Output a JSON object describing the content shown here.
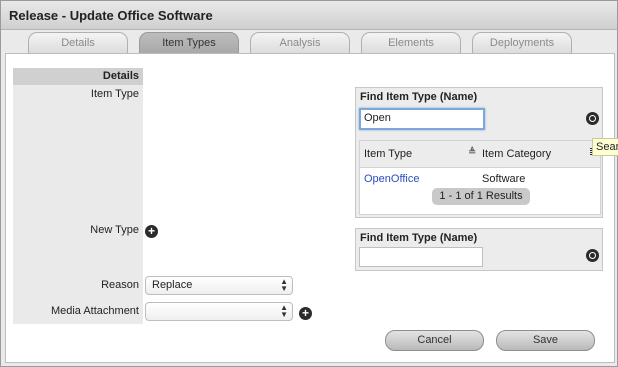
{
  "window": {
    "title": "Release - Update Office Software"
  },
  "tabs": [
    {
      "label": "Details"
    },
    {
      "label": "Item Types"
    },
    {
      "label": "Analysis"
    },
    {
      "label": "Elements"
    },
    {
      "label": "Deployments"
    }
  ],
  "form": {
    "section_title": "Details",
    "item_type_label": "Item Type",
    "new_type_label": "New Type",
    "reason_label": "Reason",
    "reason_value": "Replace",
    "media_label": "Media Attachment",
    "media_value": ""
  },
  "finder1": {
    "title": "Find Item Type (Name)",
    "search_value": "Open",
    "col_item_type": "Item Type",
    "col_item_category": "Item Category",
    "rows": [
      {
        "item_type": "OpenOffice",
        "category": "Software"
      }
    ],
    "pager": "1 - 1 of 1 Results",
    "tooltip": "Sear"
  },
  "finder2": {
    "title": "Find Item Type (Name)",
    "search_value": ""
  },
  "buttons": {
    "cancel": "Cancel",
    "save": "Save"
  },
  "icons": {
    "search": "magnifier-icon",
    "add": "plus-icon",
    "sort": "sort-icon"
  }
}
